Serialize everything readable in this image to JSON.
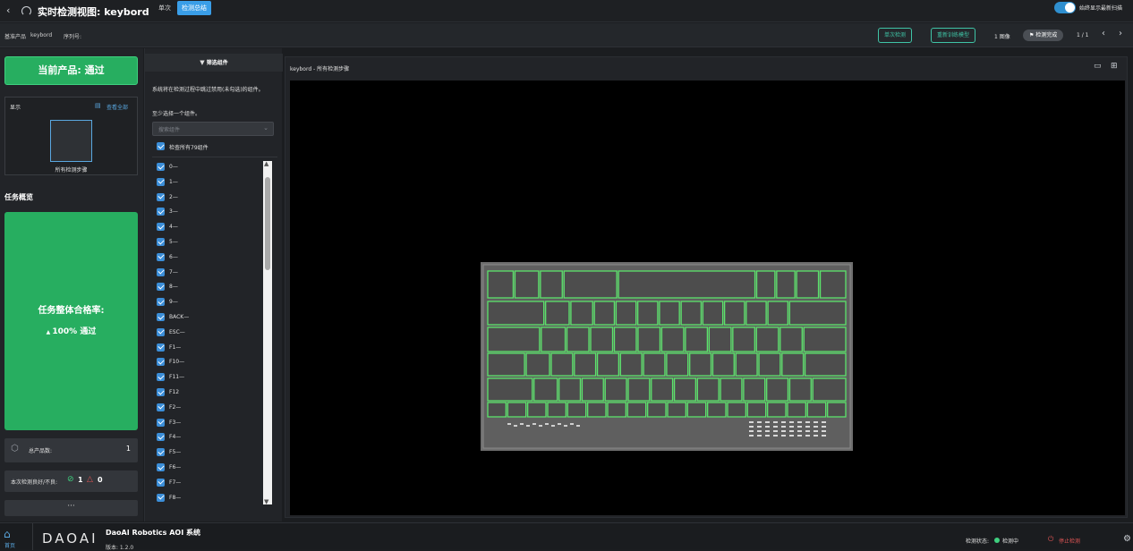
{
  "header": {
    "title": "实时检测视图: keybord",
    "tabs": [
      {
        "label": "单次"
      },
      {
        "label": "检测总结"
      }
    ],
    "toggle_label": "始终显示最新扫描"
  },
  "infobar": {
    "product_label": "基准产品",
    "product_value": "keybord",
    "serial_label": "序列号:",
    "btn_single": "单次检测",
    "btn_retrain": "重新训练模型",
    "image_count": "1 图像",
    "status_pill": "检测完成",
    "page_counter": "1 / 1"
  },
  "left": {
    "current_product": "当前产品: 通过",
    "display_label": "显示",
    "view_all": "查看全部",
    "thumb_label": "所有检测步骤",
    "task_overview": "任务概览",
    "pass_rate_title": "任务整体合格率:",
    "pass_rate_value": "100% 通过",
    "total_label": "总产品数:",
    "total_value": "1",
    "good_bad_label": "本次检测良好/不良:",
    "good_count": "1",
    "bad_count": "0",
    "more": "···"
  },
  "filter": {
    "title": "筛选组件",
    "desc": "系统将在检测过程中跳过禁用(未勾选)的组件。",
    "hint": "至少选择一个组件。",
    "search_placeholder": "搜索组件",
    "check_all": "检查所有79组件",
    "items": [
      "0—",
      "1—",
      "2—",
      "3—",
      "4—",
      "5—",
      "6—",
      "7—",
      "8—",
      "9—",
      "BACK—",
      "ESC—",
      "F1—",
      "F10—",
      "F11—",
      "F12",
      "F2—",
      "F3—",
      "F4—",
      "F5—",
      "F6—",
      "F7—",
      "F8—"
    ]
  },
  "viewer": {
    "title": "keybord - 所有检测步骤"
  },
  "footer": {
    "brand_logo": "DAOAI",
    "system_name": "DaoAI Robotics AOI 系统",
    "version": "版本: 1.2.0",
    "home_label": "首页",
    "status_label": "检测状态:",
    "status_value": "检测中",
    "stop_label": "停止检测"
  },
  "colors": {
    "accent_green": "#27ae60",
    "accent_teal": "#3fc4a6",
    "accent_blue": "#3b8ed8",
    "detect_box": "#5be36b",
    "stop_red": "#e05555"
  }
}
